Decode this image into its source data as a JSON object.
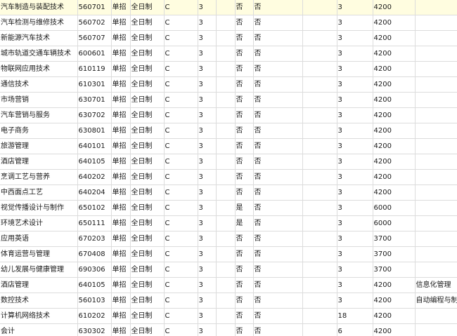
{
  "spreadsheet": {
    "rows": [
      [
        "汽车制造与装配技术",
        "560701",
        "单招",
        "全日制",
        "C",
        "3",
        "",
        "否",
        "否",
        "",
        "3",
        "4200",
        "",
        ""
      ],
      [
        "汽车检测与维修技术",
        "560702",
        "单招",
        "全日制",
        "C",
        "3",
        "",
        "否",
        "否",
        "",
        "3",
        "4200",
        "",
        ""
      ],
      [
        "新能源汽车技术",
        "560707",
        "单招",
        "全日制",
        "C",
        "3",
        "",
        "否",
        "否",
        "",
        "3",
        "4200",
        "",
        ""
      ],
      [
        "城市轨道交通车辆技术",
        "600601",
        "单招",
        "全日制",
        "C",
        "3",
        "",
        "否",
        "否",
        "",
        "3",
        "4200",
        "",
        ""
      ],
      [
        "物联网应用技术",
        "610119",
        "单招",
        "全日制",
        "C",
        "3",
        "",
        "否",
        "否",
        "",
        "3",
        "4200",
        "",
        ""
      ],
      [
        "通信技术",
        "610301",
        "单招",
        "全日制",
        "C",
        "3",
        "",
        "否",
        "否",
        "",
        "3",
        "4200",
        "",
        ""
      ],
      [
        "市场营销",
        "630701",
        "单招",
        "全日制",
        "C",
        "3",
        "",
        "否",
        "否",
        "",
        "3",
        "4200",
        "",
        ""
      ],
      [
        "汽车营销与服务",
        "630702",
        "单招",
        "全日制",
        "C",
        "3",
        "",
        "否",
        "否",
        "",
        "3",
        "4200",
        "",
        ""
      ],
      [
        "电子商务",
        "630801",
        "单招",
        "全日制",
        "C",
        "3",
        "",
        "否",
        "否",
        "",
        "3",
        "4200",
        "",
        ""
      ],
      [
        "旅游管理",
        "640101",
        "单招",
        "全日制",
        "C",
        "3",
        "",
        "否",
        "否",
        "",
        "3",
        "4200",
        "",
        ""
      ],
      [
        "酒店管理",
        "640105",
        "单招",
        "全日制",
        "C",
        "3",
        "",
        "否",
        "否",
        "",
        "3",
        "4200",
        "",
        ""
      ],
      [
        "烹调工艺与营养",
        "640202",
        "单招",
        "全日制",
        "C",
        "3",
        "",
        "否",
        "否",
        "",
        "3",
        "4200",
        "",
        ""
      ],
      [
        "中西面点工艺",
        "640204",
        "单招",
        "全日制",
        "C",
        "3",
        "",
        "否",
        "否",
        "",
        "3",
        "4200",
        "",
        ""
      ],
      [
        "视觉传播设计与制作",
        "650102",
        "单招",
        "全日制",
        "C",
        "3",
        "",
        "是",
        "否",
        "",
        "3",
        "6000",
        "",
        ""
      ],
      [
        "环境艺术设计",
        "650111",
        "单招",
        "全日制",
        "C",
        "3",
        "",
        "是",
        "否",
        "",
        "3",
        "6000",
        "",
        ""
      ],
      [
        "应用英语",
        "670203",
        "单招",
        "全日制",
        "C",
        "3",
        "",
        "否",
        "否",
        "",
        "3",
        "3700",
        "",
        ""
      ],
      [
        "体育运营与管理",
        "670408",
        "单招",
        "全日制",
        "C",
        "3",
        "",
        "否",
        "否",
        "",
        "3",
        "3700",
        "",
        ""
      ],
      [
        "幼儿发展与健康管理",
        "690306",
        "单招",
        "全日制",
        "C",
        "3",
        "",
        "否",
        "否",
        "",
        "3",
        "3700",
        "",
        ""
      ],
      [
        "酒店管理",
        "640105",
        "单招",
        "全日制",
        "C",
        "3",
        "",
        "否",
        "否",
        "",
        "3",
        "4200",
        "信息化管理",
        ""
      ],
      [
        "数控技术",
        "560103",
        "单招",
        "全日制",
        "C",
        "3",
        "",
        "否",
        "否",
        "",
        "3",
        "4200",
        "自动编程与制造",
        ""
      ],
      [
        "计算机网络技术",
        "610202",
        "单招",
        "全日制",
        "C",
        "3",
        "",
        "否",
        "否",
        "",
        "18",
        "4200",
        "",
        ""
      ],
      [
        "会计",
        "630302",
        "单招",
        "全日制",
        "C",
        "3",
        "",
        "否",
        "否",
        "",
        "6",
        "4200",
        "",
        ""
      ]
    ]
  },
  "colors": {
    "gridline": "#dcdcdc",
    "highlight_row": "#fffde0",
    "text": "#1a1a1a"
  }
}
